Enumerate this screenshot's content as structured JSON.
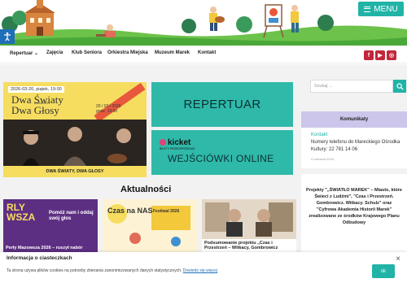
{
  "header": {
    "menu_label": "MENU"
  },
  "nav": {
    "items": [
      "Repertuar",
      "Zajęcia",
      "Klub Seniora",
      "Orkiestra Miejska",
      "Muzeum Marek",
      "Kontakt"
    ],
    "dropdown_caret": "⌄",
    "social": [
      {
        "icon": "facebook-icon",
        "glyph": "f"
      },
      {
        "icon": "youtube-icon",
        "glyph": "▶"
      },
      {
        "icon": "instagram-icon",
        "glyph": "◎"
      }
    ]
  },
  "feature": {
    "date_badge": "2026-03-20, piątek, 19:00",
    "title_line1": "Dwa Światy",
    "title_line2": "Dwa Głosy",
    "koncert": "KONCERT",
    "date_line1": "20 / 03 / 2026",
    "date_line2": "godz. 19:00",
    "caption": "DWA ŚWIATY, DWA GŁOSY"
  },
  "cards": {
    "repertuar": "REPERTUAR",
    "kicket": "kicket",
    "kicket_sub": "BILETY PRZEDSPRZEDAŻ",
    "wejsciowki": "WEJŚCIÓWKI ONLINE"
  },
  "aktualnosci": {
    "heading": "Aktualności",
    "items": [
      {
        "title": "Perły Mazowsza 2026 – ruszył nabór",
        "overlay": "Pomóż nam i oddaj swój głos"
      },
      {
        "title": "Czas na NAS",
        "overlay": "Festiwal 2026"
      },
      {
        "title": "Podsumowanie projektu „Czas i Przestrzeń – Witkacy, Gombrowicz"
      }
    ]
  },
  "sidebar": {
    "search_placeholder": "Szukaj ...",
    "komunikaty": {
      "heading": "Komunikaty",
      "item_title": "Kontakt",
      "item_body": "Numery telefonu do Mareckiego Ośrodka Kultury: 22 781 14 06",
      "item_date": "4 czerwca 2024"
    },
    "projekty": {
      "text": "Projekty \"„ŚWIATŁO MAREK\" – Miasto, które Świeci z Ludźmi\", \"Czas i Przestrzeń. Gombrowicz. Witkacy. Schulz\" oraz \"Cyfrowa Akademia Historii Marek\" zrealizowane ze środków Krajowego Planu Odbudowy"
    }
  },
  "cookie": {
    "title": "Informacja o ciasteczkach",
    "body": "Ta strona używa plików cookies na potrzeby zbierania zanonimizowanych danych statystycznych.",
    "link": "Dowiedz się więcej",
    "ok": "ok",
    "close": "×"
  }
}
